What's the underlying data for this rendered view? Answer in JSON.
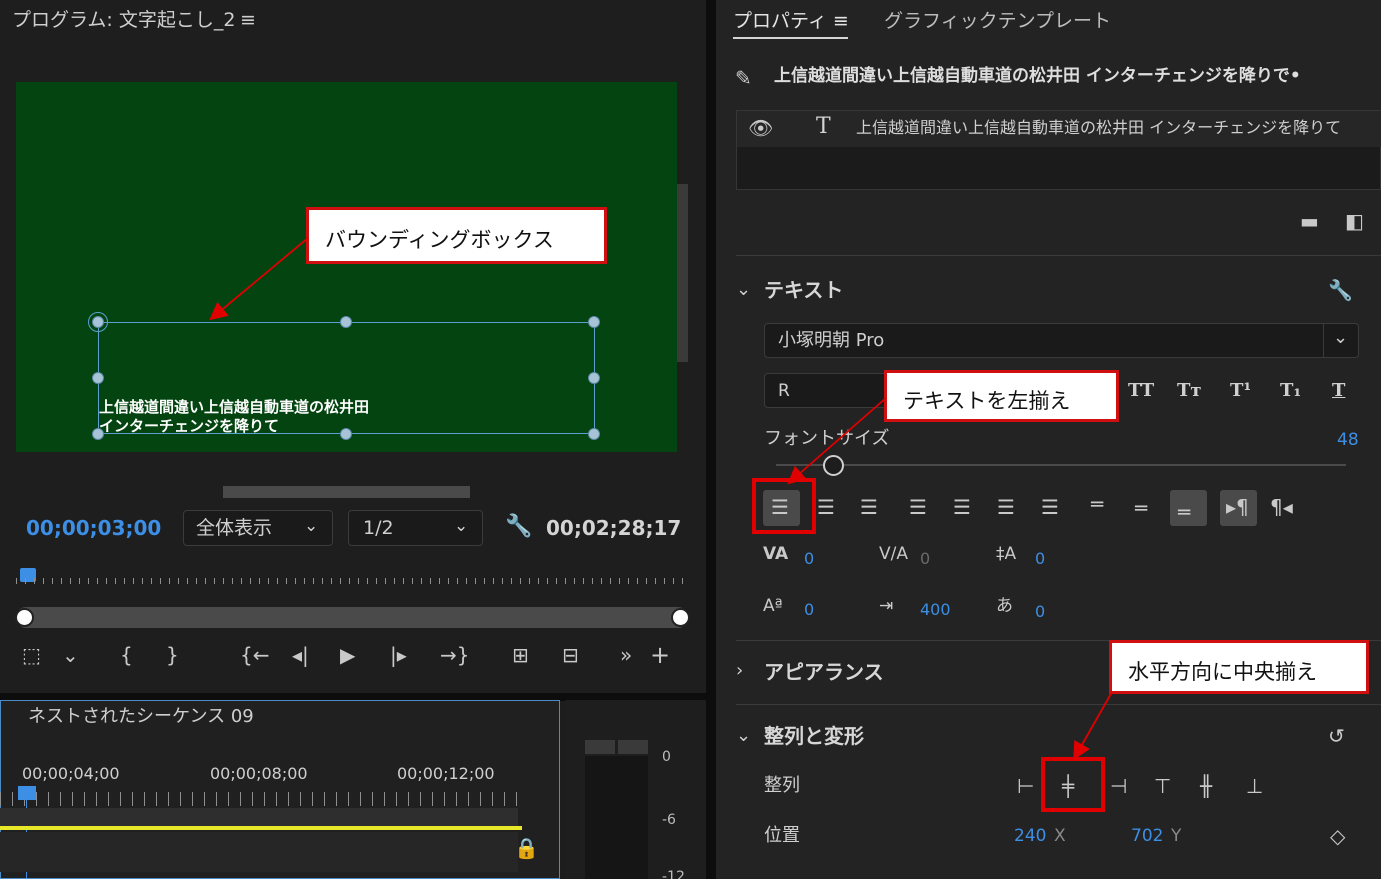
{
  "program": {
    "title": "プログラム: 文字起こし_2",
    "timecode_current": "00;00;03;00",
    "zoom_label": "全体表示",
    "resolution_label": "1/2",
    "timecode_duration": "00;02;28;17",
    "caption_line1": "上信越道間違い上信越自動車道の松井田",
    "caption_line2": "インターチェンジを降りて"
  },
  "annotations": {
    "bounding_box": "バウンディングボックス",
    "left_align": "テキストを左揃え",
    "center_horizontal": "水平方向に中央揃え"
  },
  "timeline": {
    "sequence_name": "ネストされたシーケンス 09",
    "time_labels": [
      "00;00;04;00",
      "00;00;08;00",
      "00;00;12;00"
    ]
  },
  "meter": {
    "labels": [
      "0",
      "-6",
      "-12"
    ]
  },
  "properties": {
    "tab_active": "プロパティ",
    "tab_inactive": "グラフィックテンプレート",
    "clip_title": "上信越道間違い上信越自動車道の松井田 インターチェンジを降りで•",
    "layer_name": "上信越道間違い上信越自動車道の松井田 インターチェンジを降りて",
    "text_section": "テキスト",
    "font_family": "小塚明朝 Pro",
    "font_style": "R",
    "font_size_label": "フォントサイズ",
    "font_size_value": "48",
    "font_size_fraction": 0.1,
    "style_buttons": [
      "TT",
      "Tт",
      "T¹",
      "T₁",
      "T"
    ],
    "kerning_value": "0",
    "tracking_value": "0",
    "leading_value": "0",
    "baseline_value": "0",
    "tab_width_value": "400",
    "tsume_value": "0",
    "appearance_section": "アピアランス",
    "align_section": "整列と変形",
    "align_label": "整列",
    "position_label": "位置",
    "position_x": "240",
    "position_x_unit": "X",
    "position_y": "702",
    "position_y_unit": "Y"
  }
}
